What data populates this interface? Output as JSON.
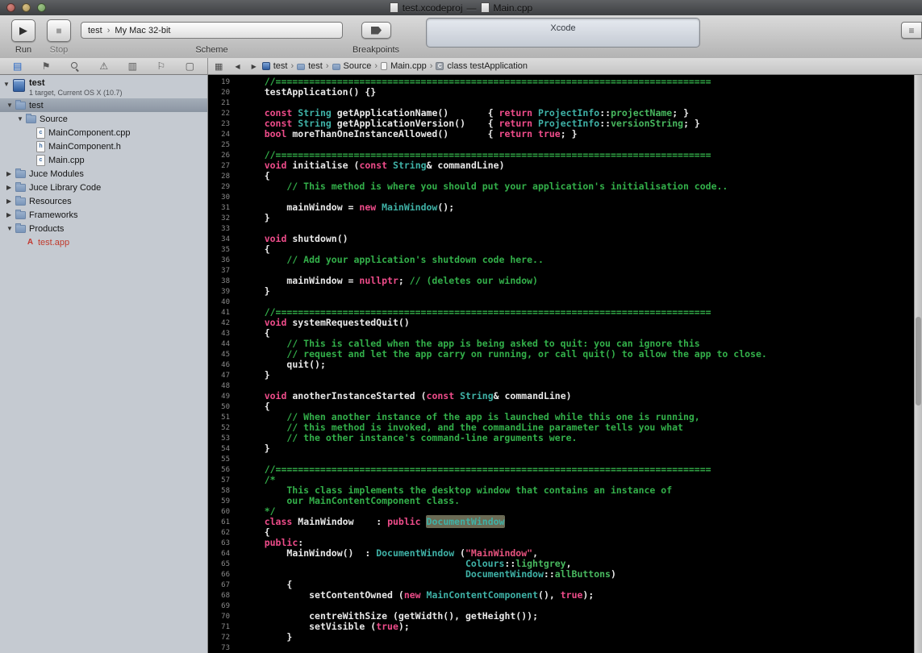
{
  "window": {
    "title_left": "test.xcodeproj",
    "title_separator": "—",
    "title_right": "Main.cpp"
  },
  "toolbar": {
    "run_label": "Run",
    "stop_label": "Stop",
    "run_glyph": "▶",
    "stop_glyph": "■",
    "scheme": {
      "target": "test",
      "destination": "My Mac 32-bit",
      "label": "Scheme"
    },
    "breakpoints_label": "Breakpoints",
    "activity_text": "Xcode"
  },
  "navigators": [
    {
      "id": "project",
      "selected": true
    },
    {
      "id": "symbol"
    },
    {
      "id": "search"
    },
    {
      "id": "issue"
    },
    {
      "id": "debug"
    },
    {
      "id": "breakpoint"
    },
    {
      "id": "log"
    }
  ],
  "jumpbar": {
    "crumbs": [
      {
        "label": "test",
        "icon": "project"
      },
      {
        "label": "test",
        "icon": "folder"
      },
      {
        "label": "Source",
        "icon": "folder"
      },
      {
        "label": "Main.cpp",
        "icon": "file"
      },
      {
        "label": "class testApplication",
        "icon": "class"
      }
    ]
  },
  "sidebar": {
    "project": {
      "name": "test",
      "subtitle": "1 target, Current OS X (10.7)"
    },
    "items": [
      {
        "label": "test",
        "depth": 1,
        "disclosure": "open",
        "icon": "folder",
        "selected": true
      },
      {
        "label": "Source",
        "depth": 2,
        "disclosure": "open",
        "icon": "folder"
      },
      {
        "label": "MainComponent.cpp",
        "depth": 3,
        "icon": "file-cpp"
      },
      {
        "label": "MainComponent.h",
        "depth": 3,
        "icon": "file-h"
      },
      {
        "label": "Main.cpp",
        "depth": 3,
        "icon": "file-cpp"
      },
      {
        "label": "Juce Modules",
        "depth": 1,
        "disclosure": "closed",
        "icon": "folder"
      },
      {
        "label": "Juce Library Code",
        "depth": 1,
        "disclosure": "closed",
        "icon": "folder"
      },
      {
        "label": "Resources",
        "depth": 1,
        "disclosure": "closed",
        "icon": "folder"
      },
      {
        "label": "Frameworks",
        "depth": 1,
        "disclosure": "closed",
        "icon": "folder"
      },
      {
        "label": "Products",
        "depth": 1,
        "disclosure": "open",
        "icon": "folder"
      },
      {
        "label": "test.app",
        "depth": 2,
        "icon": "app",
        "missing": true
      }
    ]
  },
  "colors": {
    "keyword": "#ee4c8a",
    "type": "#3fb2a7",
    "comment": "#33b04a",
    "member": "#48b85f",
    "string": "#e8537f",
    "plain": "#e9e9e9",
    "linenum": "#8a8a8a",
    "background": "#000000",
    "find_highlight": "#6b6b55"
  },
  "editor": {
    "separator": "    //==============================================================================",
    "lines": [
      {
        "n": 19,
        "s": [
          [
            "c",
            "@SEP@"
          ]
        ]
      },
      {
        "n": 20,
        "s": [
          [
            "p",
            "    "
          ],
          [
            "f",
            "testApplication()"
          ],
          [
            "p",
            " {}"
          ]
        ]
      },
      {
        "n": 21,
        "s": []
      },
      {
        "n": 22,
        "s": [
          [
            "p",
            "    "
          ],
          [
            "k",
            "const"
          ],
          [
            "p",
            " "
          ],
          [
            "t",
            "String"
          ],
          [
            "p",
            " "
          ],
          [
            "f",
            "getApplicationName()"
          ],
          [
            "p",
            "       { "
          ],
          [
            "k",
            "return"
          ],
          [
            "p",
            " "
          ],
          [
            "t",
            "ProjectInfo"
          ],
          [
            "p",
            "::"
          ],
          [
            "m",
            "projectName"
          ],
          [
            "p",
            "; }"
          ]
        ]
      },
      {
        "n": 23,
        "s": [
          [
            "p",
            "    "
          ],
          [
            "k",
            "const"
          ],
          [
            "p",
            " "
          ],
          [
            "t",
            "String"
          ],
          [
            "p",
            " "
          ],
          [
            "f",
            "getApplicationVersion()"
          ],
          [
            "p",
            "    { "
          ],
          [
            "k",
            "return"
          ],
          [
            "p",
            " "
          ],
          [
            "t",
            "ProjectInfo"
          ],
          [
            "p",
            "::"
          ],
          [
            "m",
            "versionString"
          ],
          [
            "p",
            "; }"
          ]
        ]
      },
      {
        "n": 24,
        "s": [
          [
            "p",
            "    "
          ],
          [
            "k",
            "bool"
          ],
          [
            "p",
            " "
          ],
          [
            "f",
            "moreThanOneInstanceAllowed()"
          ],
          [
            "p",
            "       { "
          ],
          [
            "k",
            "return"
          ],
          [
            "p",
            " "
          ],
          [
            "k",
            "true"
          ],
          [
            "p",
            "; }"
          ]
        ]
      },
      {
        "n": 25,
        "s": []
      },
      {
        "n": 26,
        "s": [
          [
            "c",
            "@SEP@"
          ]
        ]
      },
      {
        "n": 27,
        "s": [
          [
            "p",
            "    "
          ],
          [
            "k",
            "void"
          ],
          [
            "p",
            " "
          ],
          [
            "f",
            "initialise"
          ],
          [
            "p",
            " ("
          ],
          [
            "k",
            "const"
          ],
          [
            "p",
            " "
          ],
          [
            "t",
            "String"
          ],
          [
            "p",
            "& commandLine)"
          ]
        ]
      },
      {
        "n": 28,
        "s": [
          [
            "p",
            "    {"
          ]
        ]
      },
      {
        "n": 29,
        "s": [
          [
            "c",
            "        // This method is where you should put your application's initialisation code.."
          ]
        ]
      },
      {
        "n": 30,
        "s": []
      },
      {
        "n": 31,
        "s": [
          [
            "p",
            "        mainWindow = "
          ],
          [
            "k",
            "new"
          ],
          [
            "p",
            " "
          ],
          [
            "t",
            "MainWindow"
          ],
          [
            "p",
            "();"
          ]
        ]
      },
      {
        "n": 32,
        "s": [
          [
            "p",
            "    }"
          ]
        ]
      },
      {
        "n": 33,
        "s": []
      },
      {
        "n": 34,
        "s": [
          [
            "p",
            "    "
          ],
          [
            "k",
            "void"
          ],
          [
            "p",
            " "
          ],
          [
            "f",
            "shutdown()"
          ]
        ]
      },
      {
        "n": 35,
        "s": [
          [
            "p",
            "    {"
          ]
        ]
      },
      {
        "n": 36,
        "s": [
          [
            "c",
            "        // Add your application's shutdown code here.."
          ]
        ]
      },
      {
        "n": 37,
        "s": []
      },
      {
        "n": 38,
        "s": [
          [
            "p",
            "        mainWindow = "
          ],
          [
            "k",
            "nullptr"
          ],
          [
            "p",
            "; "
          ],
          [
            "c",
            "// (deletes our window)"
          ]
        ]
      },
      {
        "n": 39,
        "s": [
          [
            "p",
            "    }"
          ]
        ]
      },
      {
        "n": 40,
        "s": []
      },
      {
        "n": 41,
        "s": [
          [
            "c",
            "@SEP@"
          ]
        ]
      },
      {
        "n": 42,
        "s": [
          [
            "p",
            "    "
          ],
          [
            "k",
            "void"
          ],
          [
            "p",
            " "
          ],
          [
            "f",
            "systemRequestedQuit()"
          ]
        ]
      },
      {
        "n": 43,
        "s": [
          [
            "p",
            "    {"
          ]
        ]
      },
      {
        "n": 44,
        "s": [
          [
            "c",
            "        // This is called when the app is being asked to quit: you can ignore this"
          ]
        ]
      },
      {
        "n": 45,
        "s": [
          [
            "c",
            "        // request and let the app carry on running, or call quit() to allow the app to close."
          ]
        ]
      },
      {
        "n": 46,
        "s": [
          [
            "p",
            "        "
          ],
          [
            "f",
            "quit"
          ],
          [
            "p",
            "();"
          ]
        ]
      },
      {
        "n": 47,
        "s": [
          [
            "p",
            "    }"
          ]
        ]
      },
      {
        "n": 48,
        "s": []
      },
      {
        "n": 49,
        "s": [
          [
            "p",
            "    "
          ],
          [
            "k",
            "void"
          ],
          [
            "p",
            " "
          ],
          [
            "f",
            "anotherInstanceStarted"
          ],
          [
            "p",
            " ("
          ],
          [
            "k",
            "const"
          ],
          [
            "p",
            " "
          ],
          [
            "t",
            "String"
          ],
          [
            "p",
            "& commandLine)"
          ]
        ]
      },
      {
        "n": 50,
        "s": [
          [
            "p",
            "    {"
          ]
        ]
      },
      {
        "n": 51,
        "s": [
          [
            "c",
            "        // When another instance of the app is launched while this one is running,"
          ]
        ]
      },
      {
        "n": 52,
        "s": [
          [
            "c",
            "        // this method is invoked, and the commandLine parameter tells you what"
          ]
        ]
      },
      {
        "n": 53,
        "s": [
          [
            "c",
            "        // the other instance's command-line arguments were."
          ]
        ]
      },
      {
        "n": 54,
        "s": [
          [
            "p",
            "    }"
          ]
        ]
      },
      {
        "n": 55,
        "s": []
      },
      {
        "n": 56,
        "s": [
          [
            "c",
            "@SEP@"
          ]
        ]
      },
      {
        "n": 57,
        "s": [
          [
            "c",
            "    /*"
          ]
        ]
      },
      {
        "n": 58,
        "s": [
          [
            "c",
            "        This class implements the desktop window that contains an instance of"
          ]
        ]
      },
      {
        "n": 59,
        "s": [
          [
            "c",
            "        our MainContentComponent class."
          ]
        ]
      },
      {
        "n": 60,
        "s": [
          [
            "c",
            "    */"
          ]
        ]
      },
      {
        "n": 61,
        "s": [
          [
            "p",
            "    "
          ],
          [
            "k",
            "class"
          ],
          [
            "p",
            " "
          ],
          [
            "f",
            "MainWindow"
          ],
          [
            "p",
            "    : "
          ],
          [
            "k",
            "public"
          ],
          [
            "p",
            " "
          ],
          [
            "th",
            "DocumentWindow"
          ]
        ]
      },
      {
        "n": 62,
        "s": [
          [
            "p",
            "    {"
          ]
        ]
      },
      {
        "n": 63,
        "s": [
          [
            "p",
            "    "
          ],
          [
            "k",
            "public"
          ],
          [
            "p",
            ":"
          ]
        ]
      },
      {
        "n": 64,
        "s": [
          [
            "p",
            "        "
          ],
          [
            "f",
            "MainWindow()"
          ],
          [
            "p",
            "  : "
          ],
          [
            "t",
            "DocumentWindow"
          ],
          [
            "p",
            " ("
          ],
          [
            "s",
            "\"MainWindow\""
          ],
          [
            "p",
            ","
          ]
        ]
      },
      {
        "n": 65,
        "s": [
          [
            "p",
            "                                        "
          ],
          [
            "t",
            "Colours"
          ],
          [
            "p",
            "::"
          ],
          [
            "m",
            "lightgrey"
          ],
          [
            "p",
            ","
          ]
        ]
      },
      {
        "n": 66,
        "s": [
          [
            "p",
            "                                        "
          ],
          [
            "t",
            "DocumentWindow"
          ],
          [
            "p",
            "::"
          ],
          [
            "m",
            "allButtons"
          ],
          [
            "p",
            ")"
          ]
        ]
      },
      {
        "n": 67,
        "s": [
          [
            "p",
            "        {"
          ]
        ]
      },
      {
        "n": 68,
        "s": [
          [
            "p",
            "            "
          ],
          [
            "f",
            "setContentOwned"
          ],
          [
            "p",
            " ("
          ],
          [
            "k",
            "new"
          ],
          [
            "p",
            " "
          ],
          [
            "t",
            "MainContentComponent"
          ],
          [
            "p",
            "(), "
          ],
          [
            "k",
            "true"
          ],
          [
            "p",
            ");"
          ]
        ]
      },
      {
        "n": 69,
        "s": []
      },
      {
        "n": 70,
        "s": [
          [
            "p",
            "            "
          ],
          [
            "f",
            "centreWithSize"
          ],
          [
            "p",
            " ("
          ],
          [
            "f",
            "getWidth"
          ],
          [
            "p",
            "(), "
          ],
          [
            "f",
            "getHeight"
          ],
          [
            "p",
            "());"
          ]
        ]
      },
      {
        "n": 71,
        "s": [
          [
            "p",
            "            "
          ],
          [
            "f",
            "setVisible"
          ],
          [
            "p",
            " ("
          ],
          [
            "k",
            "true"
          ],
          [
            "p",
            ");"
          ]
        ]
      },
      {
        "n": 72,
        "s": [
          [
            "p",
            "        }"
          ]
        ]
      },
      {
        "n": 73,
        "s": []
      }
    ]
  }
}
